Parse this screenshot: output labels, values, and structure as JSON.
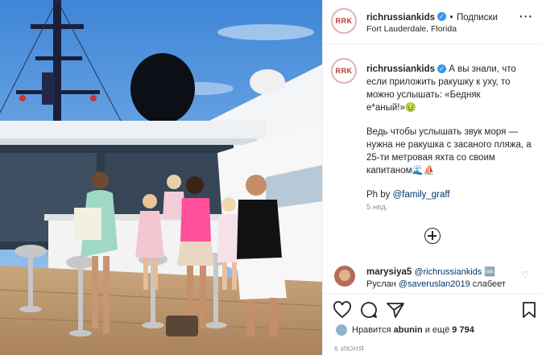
{
  "post": {
    "username": "richrussiankids",
    "verified_mark": "✓",
    "separator": "•",
    "follow_label": "Подписки",
    "location": "Fort Lauderdale, Florida",
    "avatar_text": "RRK",
    "more_icon": "more-horizontal-icon"
  },
  "caption": {
    "username": "richrussiankids",
    "text_1": "А вы знали, что если приложить ракушку к уху, то можно услышать: «Бедняк е*аный!»",
    "emoji_1": "🤢",
    "text_2": "Ведь чтобы услышать звук моря — нужна не ракушка с засаного пляжа, а 25-ти метровая яхта со своим капитаном",
    "emoji_2": "🌊⛵",
    "ph_prefix": "Ph by",
    "ph_tag": "@family_graff",
    "age": "5 нед."
  },
  "comment": {
    "username": "marysiya5",
    "mention": "@richrussiankids",
    "emoji": "🆒",
    "text_prefix": "Руслан",
    "mention2": "@saveruslan2019",
    "text_suffix": "слабеет"
  },
  "likes": {
    "prefix": "Нравится",
    "user": "abunin",
    "middle": "и ещё",
    "count": "9 794"
  },
  "date": "6 ИЮНЯ",
  "colors": {
    "link": "#00376b",
    "verified": "#3897f0",
    "secondary": "#8e8e8e",
    "border": "#efefef"
  }
}
